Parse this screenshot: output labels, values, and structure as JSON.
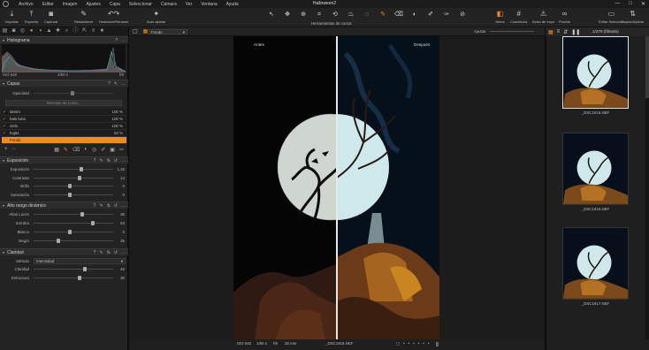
{
  "menubar": {
    "items": [
      "Archivo",
      "Editar",
      "Imagen",
      "Ajustes",
      "Capa",
      "Seleccionar",
      "Cámara",
      "Ver",
      "Ventana",
      "Ayuda"
    ],
    "title": "Halloween2",
    "window_controls": [
      "—",
      "□",
      "✕"
    ]
  },
  "toolbar": {
    "left": [
      {
        "icon": "download-icon",
        "label": "Importar",
        "glyph": "⤓"
      },
      {
        "icon": "upload-icon",
        "label": "Exportar",
        "glyph": "⤒"
      },
      {
        "icon": "camera-icon",
        "label": "Capturar",
        "glyph": "◙"
      },
      {
        "icon": "brush-icon",
        "label": "Restablecer",
        "glyph": "✎"
      },
      {
        "icon": "undo-icon",
        "label": "Deshacer/Rehacer",
        "glyph": "↶↷"
      },
      {
        "icon": "wand-icon",
        "label": "Auto ajustar",
        "glyph": "✦"
      }
    ],
    "cursor_tools_label": "Herramientas de cursor",
    "right": [
      {
        "icon": "before-after-icon",
        "label": "Antes",
        "glyph": "◧",
        "active": true
      },
      {
        "icon": "grid-icon",
        "label": "Cuadrícula",
        "glyph": "#"
      },
      {
        "icon": "warning-icon",
        "label": "Aviso de expo",
        "glyph": "⚠"
      },
      {
        "icon": "glasses-icon",
        "label": "Prueba",
        "glyph": "∞"
      },
      {
        "icon": "edit-selection-icon",
        "label": "Editar Selección",
        "glyph": "▭"
      },
      {
        "icon": "copy-apply-icon",
        "label": "Copiar/Aplicar",
        "glyph": "⇅"
      }
    ],
    "accent": "#f08c1e"
  },
  "left_panel": {
    "histogram": {
      "title": "Histograma",
      "iso": "ISO 640",
      "shutter": "1/60 s",
      "aperture": "f/8"
    },
    "layers": {
      "title": "Capas",
      "opacity_label": "Opacidad",
      "luma_button": "Intervalo de Luma...",
      "items": [
        {
          "name": "denim",
          "opacity": "100 %"
        },
        {
          "name": "halo luna",
          "opacity": "100 %"
        },
        {
          "name": "cielo",
          "opacity": "100 %"
        },
        {
          "name": "hojas",
          "opacity": "52 %"
        },
        {
          "name": "Fondo",
          "opacity": ""
        }
      ]
    },
    "exposure": {
      "title": "Exposición",
      "rows": [
        {
          "label": "Exposición",
          "value": "1,15",
          "pos": 0.6
        },
        {
          "label": "Contraste",
          "value": "14",
          "pos": 0.58
        },
        {
          "label": "Brillo",
          "value": "0",
          "pos": 0.45
        },
        {
          "label": "Saturación",
          "value": "0",
          "pos": 0.45
        }
      ]
    },
    "hdr": {
      "title": "Alto rango dinámico",
      "rows": [
        {
          "label": "Altas Luces",
          "value": "36",
          "pos": 0.62
        },
        {
          "label": "Sombra",
          "value": "63",
          "pos": 0.75
        },
        {
          "label": "Blanco",
          "value": "0",
          "pos": 0.45
        },
        {
          "label": "Negro",
          "value": "35",
          "pos": 0.3
        }
      ]
    },
    "clarity": {
      "title": "Claridad",
      "method_label": "Método",
      "method_value": "Intensidad",
      "rows": [
        {
          "label": "Claridad",
          "value": "45",
          "pos": 0.65
        },
        {
          "label": "Estructura",
          "value": "30",
          "pos": 0.58
        }
      ]
    }
  },
  "viewer": {
    "select": "Fondo",
    "fit_label": "Ajustar",
    "before_label": "Antes",
    "after_label": "Después",
    "status": {
      "iso": "ISO 640",
      "shutter": "1/60 s",
      "aperture": "f/8",
      "focal": "35 mm",
      "filename": "_DSC1915.NEF"
    }
  },
  "browser": {
    "counter": "1/279 (filtrado)",
    "thumbnails": [
      {
        "name": "_DSC1915.NEF",
        "selected": true
      },
      {
        "name": "_DSC1916.NEF",
        "selected": false
      },
      {
        "name": "_DSC1917.NEF",
        "selected": false
      }
    ]
  }
}
